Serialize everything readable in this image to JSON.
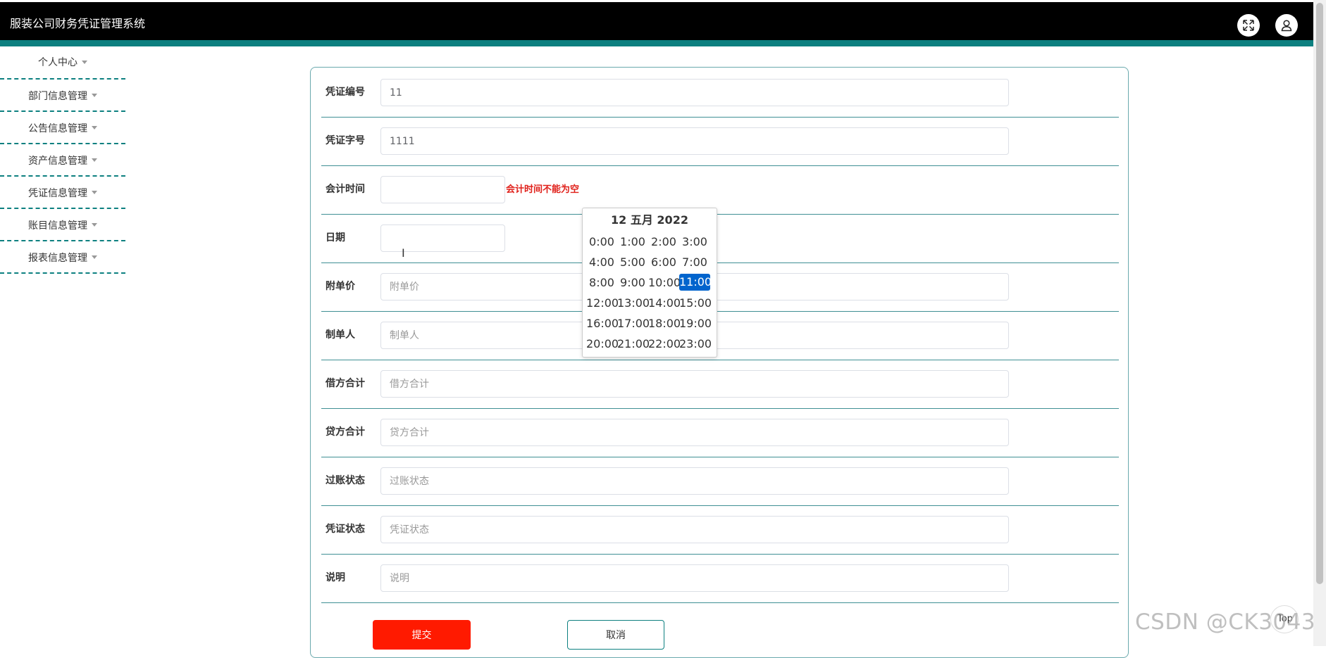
{
  "app": {
    "title": "服装公司财务凭证管理系统"
  },
  "header": {
    "fullscreen_icon": "expand-icon",
    "user_icon": "user-icon"
  },
  "sidebar": {
    "items": [
      {
        "label": "个人中心"
      },
      {
        "label": "部门信息管理"
      },
      {
        "label": "公告信息管理"
      },
      {
        "label": "资产信息管理"
      },
      {
        "label": "凭证信息管理"
      },
      {
        "label": "账目信息管理"
      },
      {
        "label": "报表信息管理"
      }
    ]
  },
  "form": {
    "fields": [
      {
        "label": "凭证编号",
        "value": "11",
        "placeholder": ""
      },
      {
        "label": "凭证字号",
        "value": "1111",
        "placeholder": ""
      },
      {
        "label": "会计时间",
        "value": "",
        "placeholder": "",
        "error": "会计时间不能为空"
      },
      {
        "label": "日期",
        "value": "",
        "placeholder": ""
      },
      {
        "label": "附单价",
        "value": "",
        "placeholder": "附单价"
      },
      {
        "label": "制单人",
        "value": "",
        "placeholder": "制单人"
      },
      {
        "label": "借方合计",
        "value": "",
        "placeholder": "借方合计"
      },
      {
        "label": "贷方合计",
        "value": "",
        "placeholder": "贷方合计"
      },
      {
        "label": "过账状态",
        "value": "",
        "placeholder": "过账状态"
      },
      {
        "label": "凭证状态",
        "value": "",
        "placeholder": "凭证状态"
      },
      {
        "label": "说明",
        "value": "",
        "placeholder": "说明"
      }
    ],
    "submit_label": "提交",
    "cancel_label": "取消"
  },
  "time_picker": {
    "title": "12 五月 2022",
    "hours": [
      "0:00",
      "1:00",
      "2:00",
      "3:00",
      "4:00",
      "5:00",
      "6:00",
      "7:00",
      "8:00",
      "9:00",
      "10:00",
      "11:00",
      "12:00",
      "13:00",
      "14:00",
      "15:00",
      "16:00",
      "17:00",
      "18:00",
      "19:00",
      "20:00",
      "21:00",
      "22:00",
      "23:00"
    ],
    "selected": "11:00"
  },
  "back_to_top": {
    "label": "Top"
  },
  "watermark": "CSDN @CK3043",
  "colors": {
    "header_bg": "#000000",
    "accent": "#0d8080",
    "submit": "#ff1a00",
    "error": "#e0201a",
    "picker_selected": "#0064cd"
  }
}
